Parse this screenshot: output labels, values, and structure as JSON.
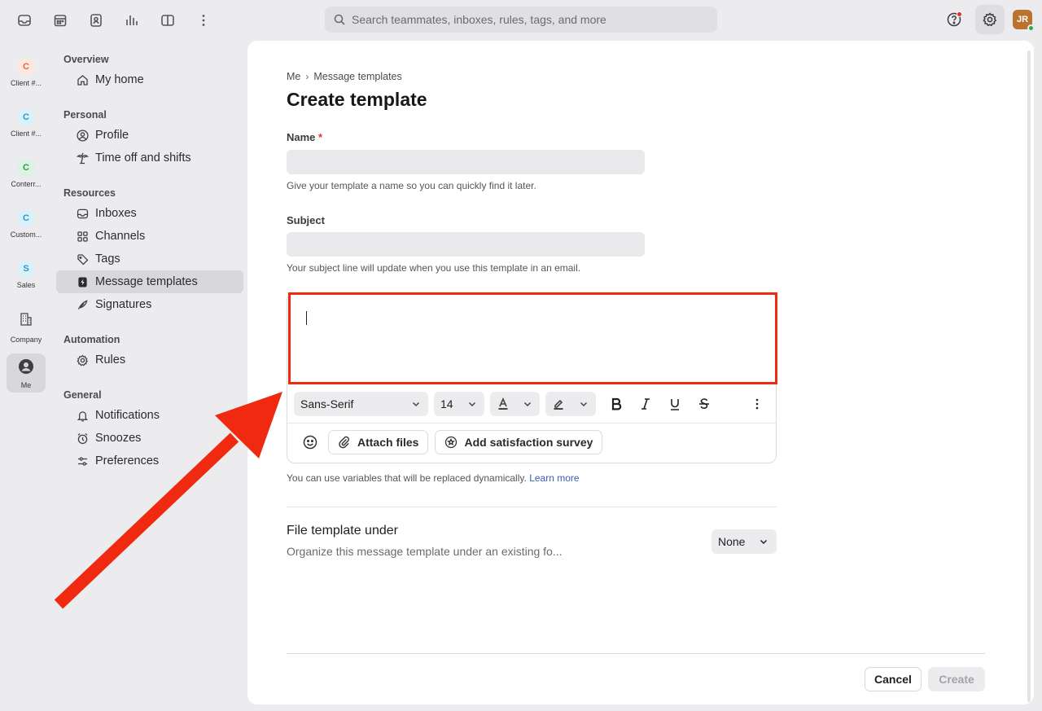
{
  "topbar": {
    "search_placeholder": "Search teammates, inboxes, rules, tags, and more",
    "avatar_initials": "JR",
    "icons": [
      "inbox-icon",
      "calendar-icon",
      "contacts-icon",
      "analytics-icon",
      "split-view-icon",
      "more-vertical-icon"
    ]
  },
  "rail": [
    {
      "badge": "C",
      "label": "Client #...",
      "color": "#e8663a",
      "bg": "#fde8df"
    },
    {
      "badge": "C",
      "label": "Client #...",
      "color": "#2a98c9",
      "bg": "#dbf1fa"
    },
    {
      "badge": "C",
      "label": "Conterr...",
      "color": "#2e9a4e",
      "bg": "#dcf3e2"
    },
    {
      "badge": "C",
      "label": "Custom...",
      "color": "#2a98c9",
      "bg": "#dbf1fa"
    },
    {
      "badge": "S",
      "label": "Sales",
      "color": "#2a98c9",
      "bg": "#dbf1fa"
    },
    {
      "label": "Company"
    },
    {
      "label": "Me"
    }
  ],
  "nav": {
    "overview": "Overview",
    "my_home": "My home",
    "personal": "Personal",
    "profile": "Profile",
    "time_off": "Time off and shifts",
    "resources": "Resources",
    "inboxes": "Inboxes",
    "channels": "Channels",
    "tags": "Tags",
    "message_templates": "Message templates",
    "signatures": "Signatures",
    "automation": "Automation",
    "rules": "Rules",
    "general": "General",
    "notifications": "Notifications",
    "snoozes": "Snoozes",
    "preferences": "Preferences"
  },
  "main": {
    "breadcrumb_root": "Me",
    "breadcrumb_sep": "›",
    "breadcrumb_current": "Message templates",
    "title": "Create template",
    "name_label": "Name",
    "name_required": "*",
    "name_value": "",
    "name_hint": "Give your template a name so you can quickly find it later.",
    "subject_label": "Subject",
    "subject_value": "",
    "subject_hint": "Your subject line will update when you use this template in an email.",
    "font_family": "Sans-Serif",
    "font_size": "14",
    "attach_files": "Attach files",
    "add_survey": "Add satisfaction survey",
    "variables_hint": "You can use variables that will be replaced dynamically.",
    "learn_more": "Learn more",
    "file_under_title": "File template under",
    "file_under_sub": "Organize this message template under an existing fo...",
    "file_under_value": "None",
    "cancel": "Cancel",
    "create": "Create"
  },
  "colors": {
    "accent_link": "#3a5fb8",
    "annotation_red": "#f02a10",
    "required_red": "#d23a31"
  }
}
